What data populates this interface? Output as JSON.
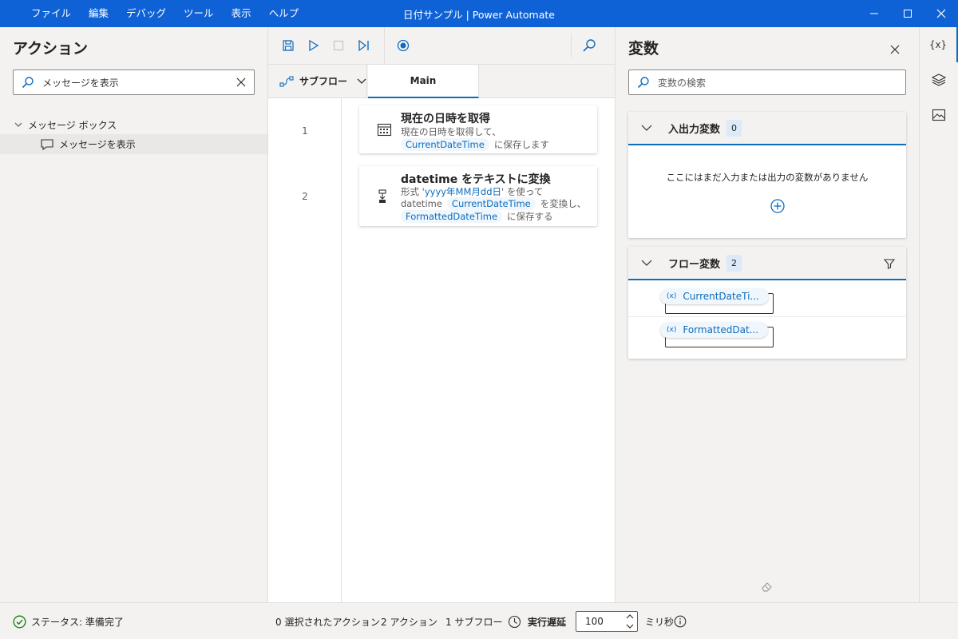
{
  "window": {
    "title": "日付サンプル | Power Automate",
    "menu": [
      "ファイル",
      "編集",
      "デバッグ",
      "ツール",
      "表示",
      "ヘルプ"
    ]
  },
  "actions_panel": {
    "title": "アクション",
    "search_value": "メッセージを表示",
    "tree_group": "メッセージ ボックス",
    "tree_item": "メッセージを表示"
  },
  "editor": {
    "subflow_label": "サブフロー",
    "tab_main": "Main",
    "steps": [
      {
        "num": "1",
        "title": "現在の日時を取得",
        "line1": "現在の日時を取得して、",
        "var": "CurrentDateTime",
        "suffix": "に保存します"
      },
      {
        "num": "2",
        "title": "datetime をテキストに変換",
        "line1_prefix": "形式 '",
        "format": "yyyy年MM月dd日",
        "line1_suffix": "' を使って",
        "line2_prefix": "datetime",
        "var_in": "CurrentDateTime",
        "line2_suffix": "を変換し、",
        "var_out": "FormattedDateTime",
        "line3_suffix": "に保存する"
      }
    ]
  },
  "variables_panel": {
    "title": "変数",
    "search_placeholder": "変数の検索",
    "io_section": {
      "title": "入出力変数",
      "count": "0",
      "empty_text": "ここにはまだ入力または出力の変数がありません"
    },
    "flow_section": {
      "title": "フロー変数",
      "count": "2",
      "vars": [
        "CurrentDateTi...",
        "FormattedDat..."
      ]
    }
  },
  "status_bar": {
    "status": "ステータス: 準備完了",
    "selected": "0 選択されたアクション",
    "actions": "2 アクション",
    "subflows": "1 サブフロー",
    "delay_label": "実行遅延",
    "delay_value": "100",
    "unit": "ミリ秒"
  },
  "colors": {
    "titlebar": "#0f62d6",
    "accent": "#0f6cbd",
    "status_ok": "#107c10"
  }
}
